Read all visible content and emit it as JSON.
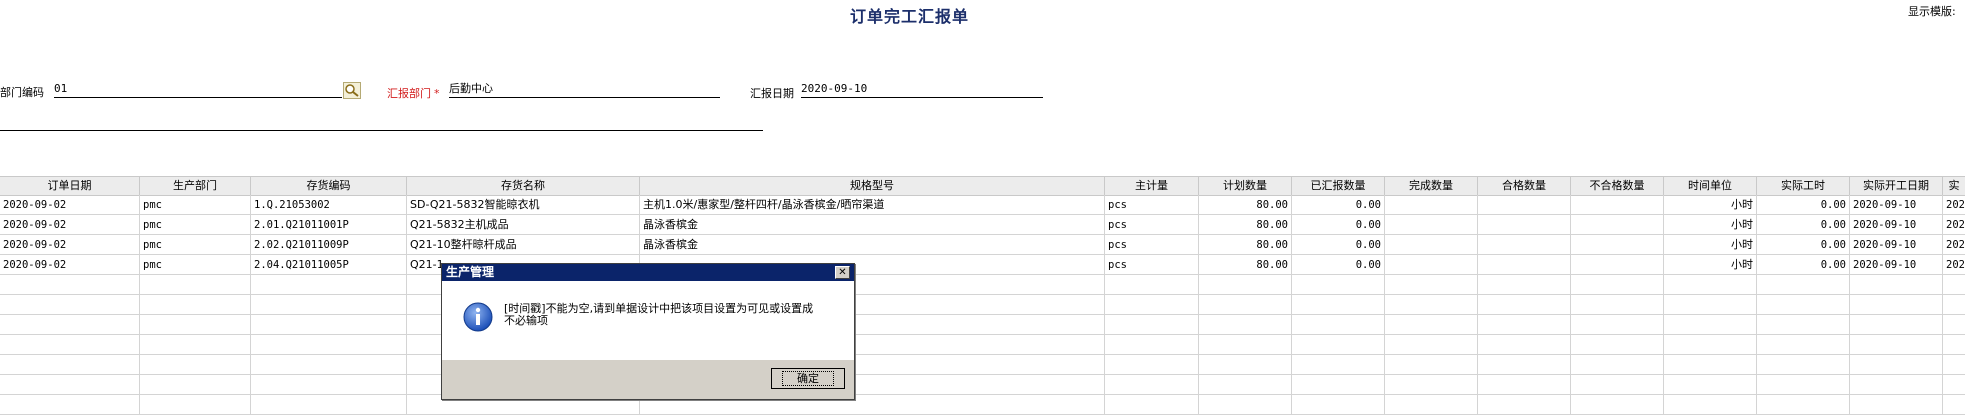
{
  "page": {
    "title": "订单完工汇报单",
    "show_template": "显示模版:"
  },
  "form": {
    "dept_code_label": "部门编码",
    "dept_code_value": "01",
    "report_dept_label": "汇报部门",
    "report_dept_required": "*",
    "report_dept_value": "后勤中心",
    "report_date_label": "汇报日期",
    "report_date_value": "2020-09-10"
  },
  "grid": {
    "columns": [
      "订单日期",
      "生产部门",
      "存货编码",
      "存货名称",
      "规格型号",
      "主计量",
      "计划数量",
      "已汇报数量",
      "完成数量",
      "合格数量",
      "不合格数量",
      "时间单位",
      "实际工时",
      "实际开工日期",
      "实"
    ],
    "rows": [
      [
        "2020-09-02",
        "pmc",
        "1.Q.21053002",
        "SD-Q21-5832智能晾衣机",
        "主机1.0米/惠家型/整杆四杆/晶泳香槟金/晒帘渠道",
        "pcs",
        "80.00",
        "0.00",
        "",
        "",
        "",
        "小时",
        "0.00",
        "2020-09-10",
        "202"
      ],
      [
        "2020-09-02",
        "pmc",
        "2.01.Q21011001P",
        "Q21-5832主机成品",
        "晶泳香槟金",
        "pcs",
        "80.00",
        "0.00",
        "",
        "",
        "",
        "小时",
        "0.00",
        "2020-09-10",
        "202"
      ],
      [
        "2020-09-02",
        "pmc",
        "2.02.Q21011009P",
        "Q21-10整杆晾杆成品",
        "晶泳香槟金",
        "pcs",
        "80.00",
        "0.00",
        "",
        "",
        "",
        "小时",
        "0.00",
        "2020-09-10",
        "202"
      ],
      [
        "2020-09-02",
        "pmc",
        "2.04.Q21011005P",
        "Q21-1",
        "",
        "pcs",
        "80.00",
        "0.00",
        "",
        "",
        "",
        "小时",
        "0.00",
        "2020-09-10",
        "202"
      ]
    ]
  },
  "dialog": {
    "title": "生产管理",
    "close_glyph": "✕",
    "message": "[时间戳]不能为空,请到单据设计中把该项目设置为可见或设置成不必输项",
    "ok_label": "确定",
    "icon": "info-icon"
  }
}
